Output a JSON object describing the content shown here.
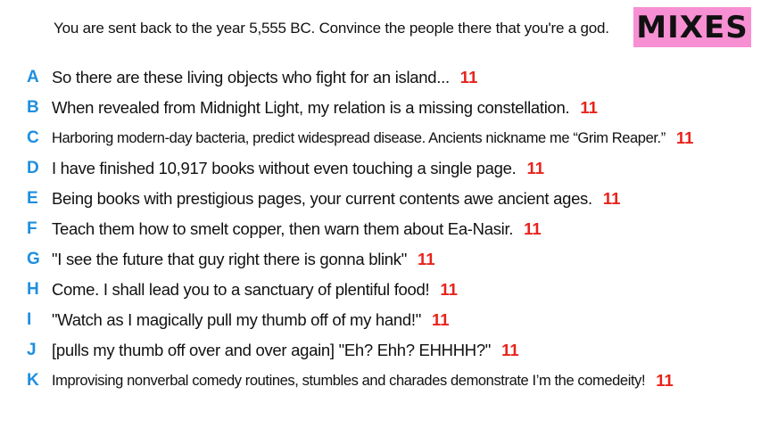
{
  "prompt": "You are sent back to the year 5,555 BC. Convince the people there that you're a god.",
  "badge": "MIXES",
  "entries": [
    {
      "letter": "A",
      "text": "So there are these living objects who fight for an island...",
      "score": "11"
    },
    {
      "letter": "B",
      "text": "When revealed from Midnight Light, my relation is a missing constellation.",
      "score": "11"
    },
    {
      "letter": "C",
      "text": "Harboring modern-day bacteria, predict widespread disease. Ancients nickname me “Grim Reaper.”",
      "score": "11"
    },
    {
      "letter": "D",
      "text": "I have finished 10,917 books without even touching a single page.",
      "score": "11"
    },
    {
      "letter": "E",
      "text": "Being books with prestigious pages, your current contents awe ancient ages.",
      "score": "11"
    },
    {
      "letter": "F",
      "text": "Teach them how to smelt copper, then warn them about Ea-Nasir.",
      "score": "11"
    },
    {
      "letter": "G",
      "text": "\"I see the future that guy right there is gonna blink\"",
      "score": "11"
    },
    {
      "letter": "H",
      "text": "Come. I shall lead you to a sanctuary of plentiful food!",
      "score": "11"
    },
    {
      "letter": "I",
      "text": "\"Watch as I magically pull my thumb off of my hand!\"",
      "score": "11"
    },
    {
      "letter": "J",
      "text": "[pulls my thumb off over and over again] \"Eh? Ehh? EHHHH?\"",
      "score": "11"
    },
    {
      "letter": "K",
      "text": "Improvising nonverbal comedy routines, stumbles and charades demonstrate I’m the comedeity!",
      "score": "11"
    }
  ],
  "colors": {
    "letter": "#1e8fe0",
    "score": "#e8221b",
    "badge_bg": "#f78fd3"
  }
}
